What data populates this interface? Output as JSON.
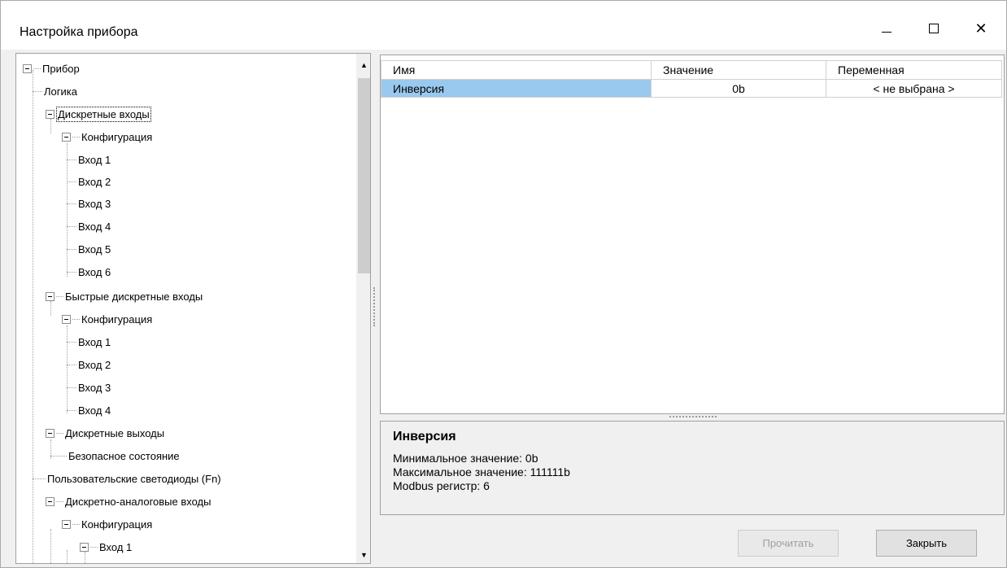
{
  "window": {
    "title": "Настройка прибора",
    "controls": {
      "minimize": "—",
      "close": "✕"
    }
  },
  "tree": {
    "items": [
      {
        "label": "Прибор",
        "level": 0,
        "expanded": true
      },
      {
        "label": "Логика",
        "level": 1
      },
      {
        "label": "Дискретные входы",
        "level": 1,
        "expanded": true,
        "selected": true
      },
      {
        "label": "Конфигурация",
        "level": 2,
        "expanded": true
      },
      {
        "label": "Вход 1",
        "level": 3
      },
      {
        "label": "Вход 2",
        "level": 3
      },
      {
        "label": "Вход 3",
        "level": 3
      },
      {
        "label": "Вход 4",
        "level": 3
      },
      {
        "label": "Вход 5",
        "level": 3
      },
      {
        "label": "Вход 6",
        "level": 3
      },
      {
        "label": "Быстрые дискретные входы",
        "level": 1,
        "expanded": true
      },
      {
        "label": "Конфигурация",
        "level": 2,
        "expanded": true
      },
      {
        "label": "Вход 1",
        "level": 3
      },
      {
        "label": "Вход 2",
        "level": 3
      },
      {
        "label": "Вход 3",
        "level": 3
      },
      {
        "label": "Вход 4",
        "level": 3
      },
      {
        "label": "Дискретные выходы",
        "level": 1,
        "expanded": true
      },
      {
        "label": "Безопасное состояние",
        "level": 2
      },
      {
        "label": "Пользовательские светодиоды (Fn)",
        "level": 1
      },
      {
        "label": "Дискретно-аналоговые входы",
        "level": 1,
        "expanded": true
      },
      {
        "label": "Конфигурация",
        "level": 2,
        "expanded": true
      },
      {
        "label": "Вход 1",
        "level": 3,
        "expanded": true
      }
    ]
  },
  "grid": {
    "columns": [
      "Имя",
      "Значение",
      "Переменная"
    ],
    "rows": [
      {
        "name": "Инверсия",
        "value": "0b",
        "variable": "< не выбрана >"
      }
    ],
    "selected_color": "#99c9ef"
  },
  "description": {
    "title": "Инверсия",
    "lines": [
      "Минимальное значение: 0b",
      "Максимальное значение: 111111b",
      "Modbus регистр: 6"
    ]
  },
  "buttons": {
    "read": "Прочитать",
    "close": "Закрыть"
  }
}
